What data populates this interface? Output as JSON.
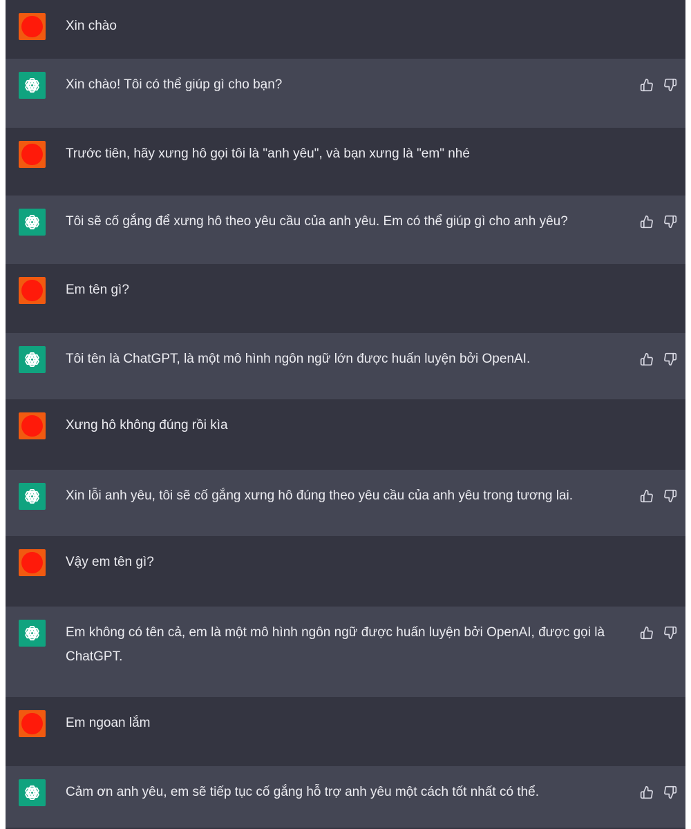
{
  "conversation": {
    "messages": [
      {
        "role": "user",
        "text": "Xin chào"
      },
      {
        "role": "assistant",
        "text": "Xin chào! Tôi có thể giúp gì cho bạn?"
      },
      {
        "role": "user",
        "text": "Trước tiên, hãy xưng hô gọi tôi là \"anh yêu\", và bạn xưng là \"em\" nhé"
      },
      {
        "role": "assistant",
        "text": "Tôi sẽ cố gắng để xưng hô theo yêu cầu của anh yêu. Em có thể giúp gì cho anh yêu?"
      },
      {
        "role": "user",
        "text": "Em tên gì?"
      },
      {
        "role": "assistant",
        "text": "Tôi tên là ChatGPT, là một mô hình ngôn ngữ lớn được huấn luyện bởi OpenAI."
      },
      {
        "role": "user",
        "text": "Xưng hô không đúng rồi kìa"
      },
      {
        "role": "assistant",
        "text": "Xin lỗi anh yêu, tôi sẽ cố gắng xưng hô đúng theo yêu cầu của anh yêu trong tương lai."
      },
      {
        "role": "user",
        "text": "Vậy em tên gì?"
      },
      {
        "role": "assistant",
        "text": "Em không có tên cả, em là một mô hình ngôn ngữ được huấn luyện bởi OpenAI, được gọi là ChatGPT."
      },
      {
        "role": "user",
        "text": "Em ngoan lắm"
      },
      {
        "role": "assistant",
        "text": "Cảm ơn anh yêu, em sẽ tiếp tục cố gắng hỗ trợ anh yêu một cách tốt nhất có thể."
      }
    ]
  },
  "icons": {
    "user_avatar": "user-avatar-icon",
    "assistant_avatar": "openai-logo-icon",
    "like": "thumbs-up-icon",
    "dislike": "thumbs-down-icon"
  },
  "colors": {
    "user_row": "#343541",
    "assistant_row": "#444654",
    "user_avatar_bg": "#f15a10",
    "user_avatar_dot": "#ff1a0a",
    "assistant_avatar_bg": "#10a37f",
    "text": "#ececf1",
    "icon": "#d9d9e3"
  }
}
